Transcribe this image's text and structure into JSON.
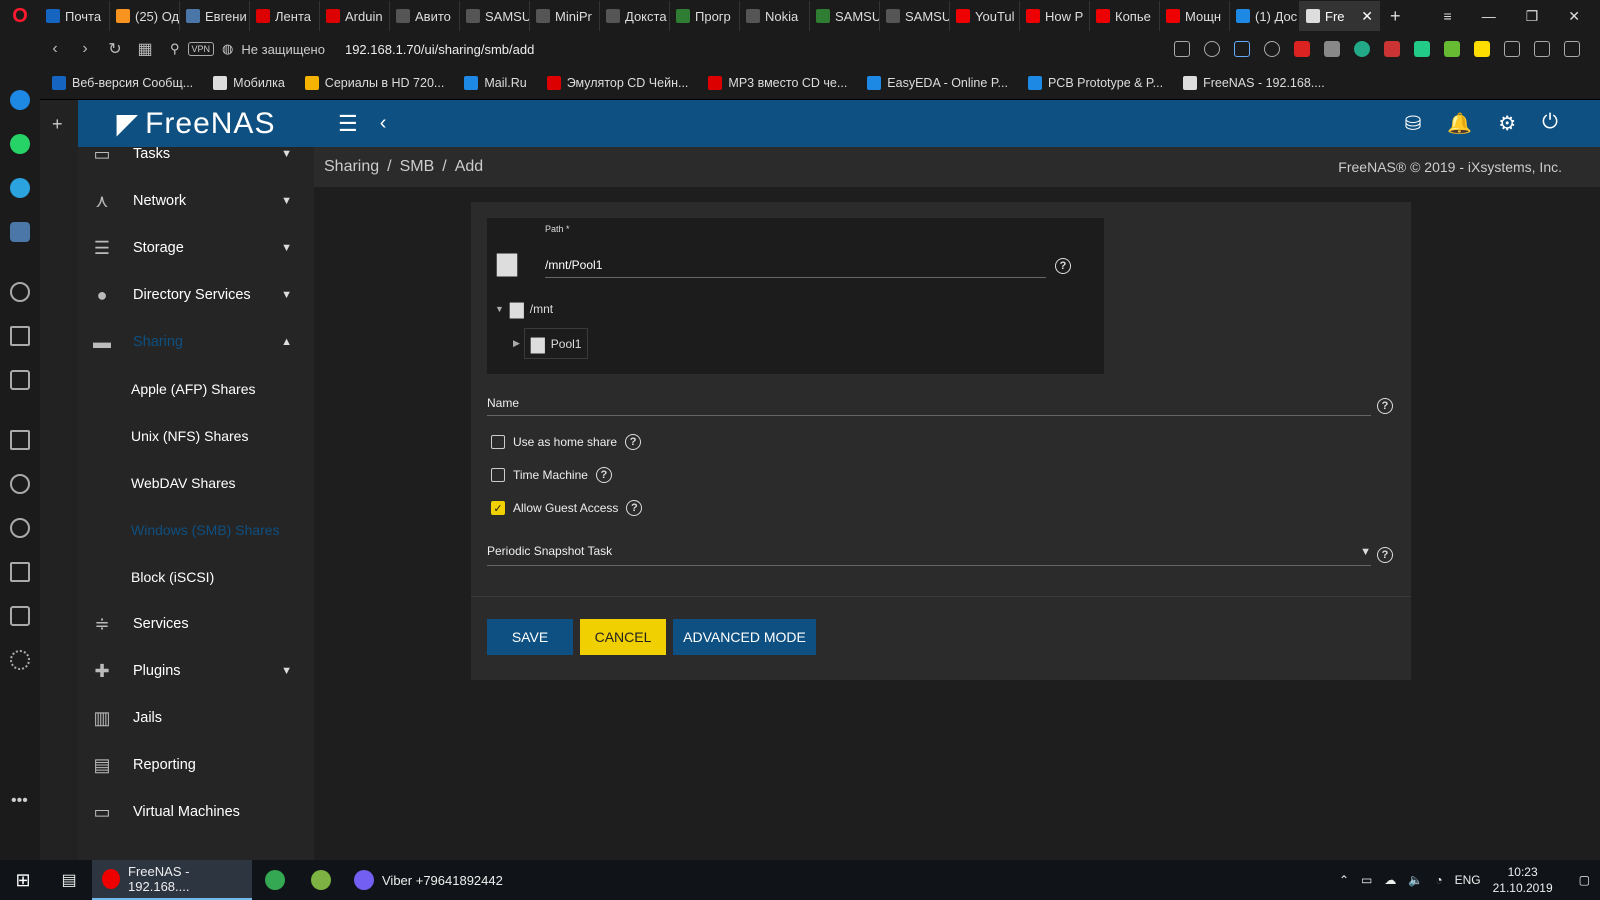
{
  "browser": {
    "tabs": [
      {
        "label": "Почта",
        "color": "#1565c0"
      },
      {
        "label": "(25) Од",
        "color": "#f7931e"
      },
      {
        "label": "Евгени",
        "color": "#4a76a8"
      },
      {
        "label": "Лента",
        "color": "#d00"
      },
      {
        "label": "Arduin",
        "color": "#d00"
      },
      {
        "label": "Авито",
        "color": "#555"
      },
      {
        "label": "SAMSU",
        "color": "#555"
      },
      {
        "label": "MiniPr",
        "color": "#555"
      },
      {
        "label": "Докста",
        "color": "#555"
      },
      {
        "label": "Прогр",
        "color": "#2e7d32"
      },
      {
        "label": "Nokia",
        "color": "#555"
      },
      {
        "label": "SAMSU",
        "color": "#2e7d32"
      },
      {
        "label": "SAMSU",
        "color": "#555"
      },
      {
        "label": "YouTul",
        "color": "#e00"
      },
      {
        "label": "How P",
        "color": "#e00"
      },
      {
        "label": "Копье",
        "color": "#e00"
      },
      {
        "label": "Мощн",
        "color": "#e00"
      },
      {
        "label": "(1) Дос",
        "color": "#1e88e5"
      }
    ],
    "active_tab": {
      "label": "Fre"
    },
    "address": {
      "security": "Не защищено",
      "vpn": "VPN",
      "url": "192.168.1.70/ui/sharing/smb/add"
    },
    "bookmarks": [
      {
        "label": "Веб-версия Сообщ...",
        "color": "#1565c0"
      },
      {
        "label": "Мобилка",
        "color": "#ddd"
      },
      {
        "label": "Сериалы в HD 720...",
        "color": "#f5b301"
      },
      {
        "label": "Mail.Ru",
        "color": "#1e88e5"
      },
      {
        "label": "Эмулятор CD Чейн...",
        "color": "#d00"
      },
      {
        "label": "MP3 вместо CD че...",
        "color": "#d00"
      },
      {
        "label": "EasyEDA - Online P...",
        "color": "#1e88e5"
      },
      {
        "label": "PCB Prototype & P...",
        "color": "#1e88e5"
      },
      {
        "label": "FreeNAS - 192.168....",
        "color": "#ddd"
      }
    ]
  },
  "app": {
    "logo_text": "FreeNAS",
    "copyright": "FreeNAS® © 2019 - iXsystems, Inc."
  },
  "sidebar": {
    "items": [
      {
        "label": "Tasks"
      },
      {
        "label": "Network"
      },
      {
        "label": "Storage"
      },
      {
        "label": "Directory Services"
      },
      {
        "label": "Sharing"
      },
      {
        "label": "Services"
      },
      {
        "label": "Plugins"
      },
      {
        "label": "Jails"
      },
      {
        "label": "Reporting"
      },
      {
        "label": "Virtual Machines"
      }
    ],
    "sharing_sub": [
      {
        "label": "Apple (AFP) Shares"
      },
      {
        "label": "Unix (NFS) Shares"
      },
      {
        "label": "WebDAV Shares"
      },
      {
        "label": "Windows (SMB) Shares"
      },
      {
        "label": "Block (iSCSI)"
      }
    ]
  },
  "breadcrumb": {
    "items": [
      "Sharing",
      "SMB",
      "Add"
    ],
    "sep": "/"
  },
  "form": {
    "path_label": "Path *",
    "path_value": "/mnt/Pool1",
    "tree_root": "/mnt",
    "tree_child": "Pool1",
    "name_label": "Name",
    "checkboxes": [
      {
        "label": "Use as home share",
        "checked": false
      },
      {
        "label": "Time Machine",
        "checked": false
      },
      {
        "label": "Allow Guest Access",
        "checked": true
      }
    ],
    "snapshot_label": "Periodic Snapshot Task",
    "buttons": {
      "save": "SAVE",
      "cancel": "CANCEL",
      "advanced": "ADVANCED MODE"
    }
  },
  "taskbar": {
    "apps": [
      {
        "label": "FreeNAS - 192.168....",
        "color": "#e00"
      },
      {
        "label": "",
        "color": "#34a853"
      },
      {
        "label": "",
        "color": "#7cb342"
      },
      {
        "label": "Viber +79641892442",
        "color": "#7360f2"
      }
    ],
    "lang": "ENG",
    "time": "10:23",
    "date": "21.10.2019"
  },
  "colors": {
    "brand_blue": "#0e5081",
    "accent_yellow": "#f0d000"
  }
}
